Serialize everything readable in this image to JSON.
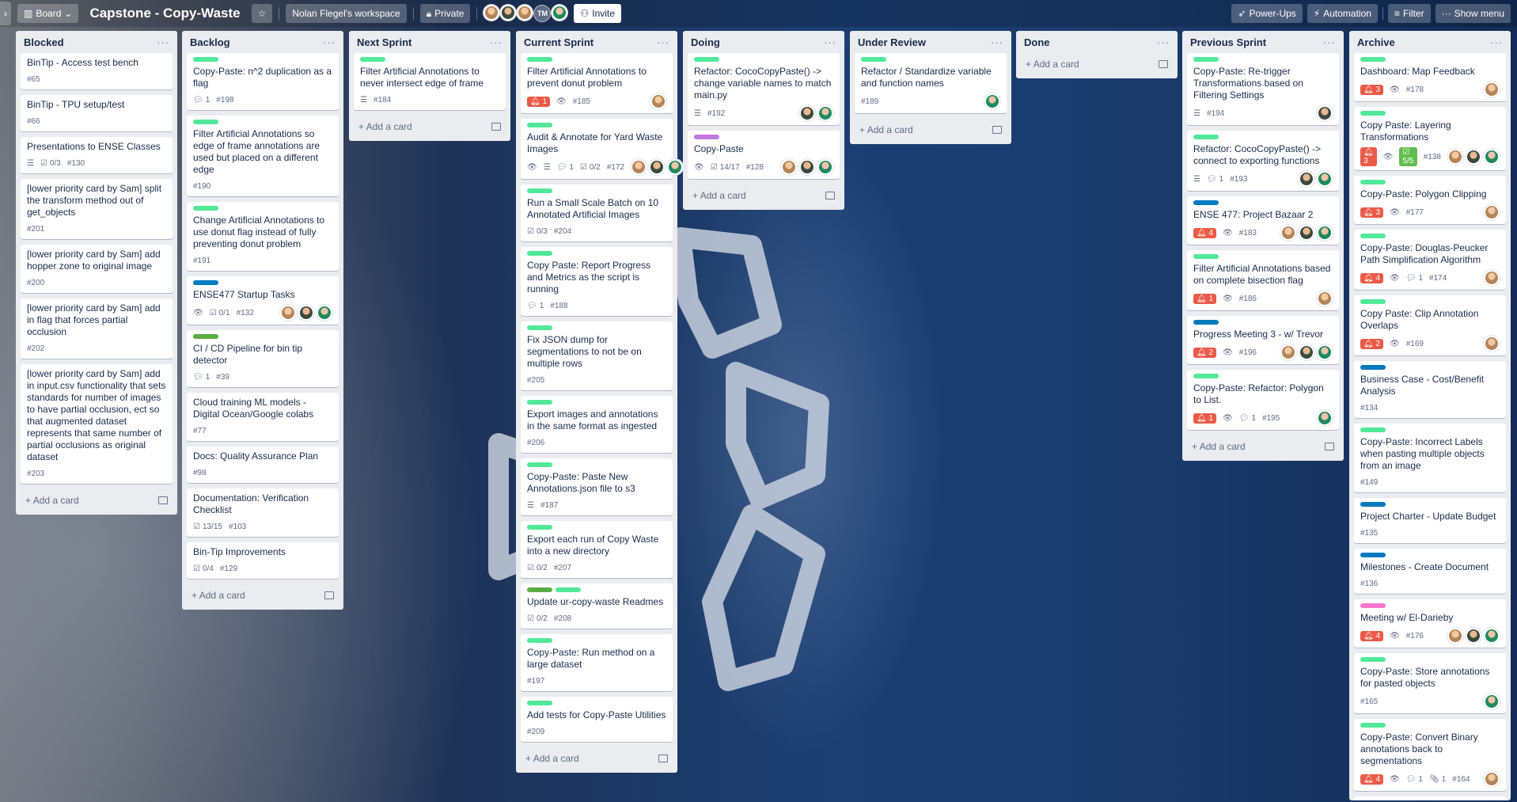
{
  "header": {
    "board_switcher": "Board",
    "board_title": "Capstone - Copy-Waste",
    "workspace": "Nolan Flegel's workspace",
    "visibility": "Private",
    "member_initials": "TM",
    "invite": "Invite",
    "power_ups": "Power-Ups",
    "automation": "Automation",
    "filter": "Filter",
    "show_menu": "Show menu"
  },
  "colors": {
    "green": "#61bd4f",
    "teal": "#51e898",
    "blue": "#0079bf",
    "purple": "#c377e0",
    "pink": "#ff78cb",
    "lime": "#5aac44",
    "red": "#eb5a46"
  },
  "add_card_label": "Add a card",
  "lists": [
    {
      "title": "Blocked",
      "cards": [
        {
          "title": "BinTip - Access test bench",
          "labels": [],
          "id": "#65"
        },
        {
          "title": "BinTip - TPU setup/test",
          "labels": [],
          "id": "#66"
        },
        {
          "title": "Presentations to ENSE Classes",
          "labels": [],
          "desc": true,
          "checklist": "0/3",
          "id": "#130"
        },
        {
          "title": "[lower priority card by Sam] split the transform method out of get_objects",
          "labels": [],
          "id": "#201"
        },
        {
          "title": "[lower priority card by Sam] add hopper zone to original image",
          "labels": [],
          "id": "#200"
        },
        {
          "title": "[lower priority card by Sam] add in flag that forces partial occlusion",
          "labels": [],
          "id": "#202"
        },
        {
          "title": "[lower priority card by Sam] add in input.csv functionality that sets standards for number of images to have partial occlusion, ect so that augmented dataset represents that same number of partial occlusions as original dataset",
          "labels": [],
          "id": "#203"
        }
      ]
    },
    {
      "title": "Backlog",
      "cards": [
        {
          "title": "Copy-Paste: n^2 duplication as a flag",
          "labels": [
            "teal"
          ],
          "comments": "1",
          "id": "#198"
        },
        {
          "title": "Filter Artificial Annotations so edge of frame annotations are used but placed on a different edge",
          "labels": [
            "teal"
          ],
          "id": "#190"
        },
        {
          "title": "Change Artificial Annotations to use donut flag instead of fully preventing donut problem",
          "labels": [
            "teal"
          ],
          "id": "#191"
        },
        {
          "title": "ENSE477 Startup Tasks",
          "labels": [
            "blue"
          ],
          "watch": true,
          "checklist": "0/1",
          "id": "#132",
          "members": [
            "a",
            "b",
            "c"
          ]
        },
        {
          "title": "CI / CD Pipeline for bin tip detector",
          "labels": [
            "lime"
          ],
          "comments": "1",
          "id": "#39"
        },
        {
          "title": "Cloud training ML models - Digital Ocean/Google colabs",
          "labels": [],
          "id": "#77"
        },
        {
          "title": "Docs: Quality Assurance Plan",
          "labels": [],
          "id": "#98"
        },
        {
          "title": "Documentation: Verification Checklist",
          "labels": [],
          "checklist": "13/15",
          "id": "#103"
        },
        {
          "title": "Bin-Tip Improvements",
          "labels": [],
          "checklist": "0/4",
          "id": "#129"
        }
      ]
    },
    {
      "title": "Next Sprint",
      "cards": [
        {
          "title": "Filter Artificial Annotations to never intersect edge of frame",
          "labels": [
            "teal"
          ],
          "desc": true,
          "id": "#184"
        }
      ]
    },
    {
      "title": "Current Sprint",
      "cards": [
        {
          "title": "Filter Artificial Annotations to prevent donut problem",
          "labels": [
            "teal"
          ],
          "alert": "1",
          "watch": true,
          "id": "#185",
          "members": [
            "a"
          ]
        },
        {
          "title": "Audit & Annotate for Yard Waste Images",
          "labels": [
            "teal"
          ],
          "watch": true,
          "desc": true,
          "comments": "1",
          "checklist": "0/2",
          "id": "#172",
          "members": [
            "a",
            "b",
            "c"
          ]
        },
        {
          "title": "Run a Small Scale Batch on 10 Annotated Artificial Images",
          "labels": [
            "teal"
          ],
          "checklist": "0/3",
          "id": "#204"
        },
        {
          "title": "Copy Paste: Report Progress and Metrics as the script is running",
          "labels": [
            "teal"
          ],
          "comments": "1",
          "id": "#188"
        },
        {
          "title": "Fix JSON dump for segmentations to not be on multiple rows",
          "labels": [
            "teal"
          ],
          "id": "#205"
        },
        {
          "title": "Export images and annotations in the same format as ingested",
          "labels": [
            "teal"
          ],
          "id": "#206"
        },
        {
          "title": "Copy-Paste: Paste New Annotations.json file to s3",
          "labels": [
            "teal"
          ],
          "desc": true,
          "id": "#187"
        },
        {
          "title": "Export each run of Copy Waste into a new directory",
          "labels": [
            "teal"
          ],
          "checklist": "0/2",
          "id": "#207"
        },
        {
          "title": "Update ur-copy-waste Readmes",
          "labels": [
            "lime",
            "teal"
          ],
          "checklist": "0/2",
          "id": "#208"
        },
        {
          "title": "Copy-Paste: Run method on a large dataset",
          "labels": [
            "teal"
          ],
          "id": "#197"
        },
        {
          "title": "Add tests for Copy-Paste Utilities",
          "labels": [
            "teal"
          ],
          "id": "#209"
        }
      ]
    },
    {
      "title": "Doing",
      "cards": [
        {
          "title": "Refactor: CocoCopyPaste() -> change variable names to match main.py",
          "labels": [
            "teal"
          ],
          "desc": true,
          "id": "#192",
          "members": [
            "b",
            "c"
          ]
        },
        {
          "title": "Copy-Paste",
          "labels": [
            "purple"
          ],
          "watch": true,
          "checklist": "14/17",
          "id": "#128",
          "members": [
            "a",
            "b",
            "c"
          ]
        }
      ]
    },
    {
      "title": "Under Review",
      "cards": [
        {
          "title": "Refactor / Standardize variable and function names",
          "labels": [
            "teal"
          ],
          "id": "#189",
          "members": [
            "c"
          ]
        }
      ]
    },
    {
      "title": "Done",
      "cards": []
    },
    {
      "title": "Previous Sprint",
      "cards": [
        {
          "title": "Copy-Paste: Re-trigger Transformations based on Filtering Settings",
          "labels": [
            "teal"
          ],
          "desc": true,
          "id": "#194",
          "members": [
            "b"
          ]
        },
        {
          "title": "Refactor: CocoCopyPaste() -> connect to exporting functions",
          "labels": [
            "teal"
          ],
          "desc": true,
          "comments": "1",
          "id": "#193",
          "members": [
            "b",
            "c"
          ]
        },
        {
          "title": "ENSE 477: Project Bazaar 2",
          "labels": [
            "blue"
          ],
          "alert": "4",
          "watch": true,
          "id": "#183",
          "members": [
            "a",
            "b",
            "c"
          ]
        },
        {
          "title": "Filter Artificial Annotations based on complete bisection flag",
          "labels": [
            "teal"
          ],
          "alert": "1",
          "watch": true,
          "id": "#186",
          "members": [
            "a"
          ]
        },
        {
          "title": "Progress Meeting 3 - w/ Trevor",
          "labels": [
            "blue"
          ],
          "alert": "2",
          "watch": true,
          "id": "#196",
          "members": [
            "a",
            "b",
            "c"
          ]
        },
        {
          "title": "Copy-Paste: Refactor: Polygon to List.",
          "labels": [
            "teal"
          ],
          "alert": "1",
          "watch": true,
          "comments": "1",
          "id": "#195",
          "members": [
            "c"
          ]
        }
      ]
    },
    {
      "title": "Archive",
      "cards": [
        {
          "title": "Dashboard: Map Feedback",
          "labels": [
            "teal"
          ],
          "alert": "3",
          "watch": true,
          "id": "#178",
          "members": [
            "a"
          ]
        },
        {
          "title": "Copy Paste: Layering Transformations",
          "labels": [
            "teal"
          ],
          "alert": "3",
          "watch": true,
          "checklist_done": "5/5",
          "id": "#138",
          "members": [
            "a",
            "b",
            "c"
          ]
        },
        {
          "title": "Copy-Paste: Polygon Clipping",
          "labels": [
            "teal"
          ],
          "alert": "3",
          "watch": true,
          "id": "#177",
          "members": [
            "a"
          ]
        },
        {
          "title": "Copy-Paste: Douglas-Peucker Path Simplification Algorithm",
          "labels": [
            "teal"
          ],
          "alert": "4",
          "watch": true,
          "comments": "1",
          "id": "#174",
          "members": [
            "a"
          ]
        },
        {
          "title": "Copy Paste: Clip Annotation Overlaps",
          "labels": [
            "teal"
          ],
          "alert": "2",
          "watch": true,
          "id": "#169",
          "members": [
            "a"
          ]
        },
        {
          "title": "Business Case - Cost/Benefit Analysis",
          "labels": [
            "blue"
          ],
          "id": "#134"
        },
        {
          "title": "Copy-Paste: Incorrect Labels when pasting multiple objects from an image",
          "labels": [
            "teal"
          ],
          "id": "#149"
        },
        {
          "title": "Project Charter - Update Budget",
          "labels": [
            "blue"
          ],
          "id": "#135"
        },
        {
          "title": "Milestones - Create Document",
          "labels": [
            "blue"
          ],
          "id": "#136"
        },
        {
          "title": "Meeting w/ El-Darieby",
          "labels": [
            "pink"
          ],
          "alert": "4",
          "watch": true,
          "id": "#176",
          "members": [
            "a",
            "b",
            "c"
          ]
        },
        {
          "title": "Copy-Paste: Store annotations for pasted objects",
          "labels": [
            "teal"
          ],
          "id": "#165",
          "members": [
            "c"
          ]
        },
        {
          "title": "Copy-Paste: Convert Binary annotations back to segmentations",
          "labels": [
            "teal"
          ],
          "alert": "4",
          "watch": true,
          "comments": "1",
          "attach": "1",
          "id": "#164",
          "members": [
            "a"
          ]
        },
        {
          "title": "",
          "labels": [
            "teal"
          ],
          "id": ""
        }
      ]
    }
  ]
}
